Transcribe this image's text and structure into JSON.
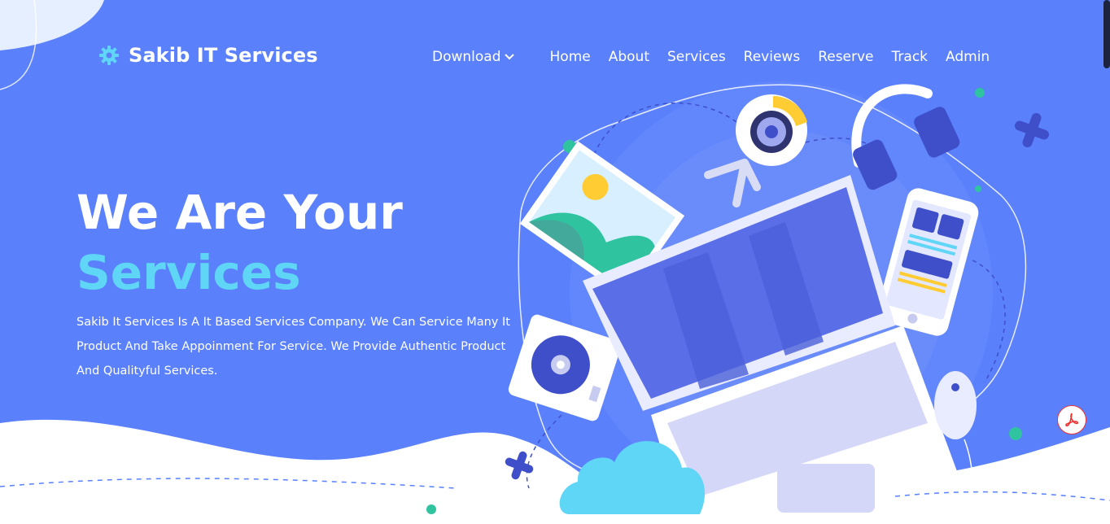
{
  "brand": {
    "name": "Sakib IT Services",
    "icon": "gear-icon"
  },
  "nav": {
    "download": {
      "label": "Download",
      "icon": "chevron-down-icon"
    },
    "items": [
      {
        "label": "Home"
      },
      {
        "label": "About"
      },
      {
        "label": "Services"
      },
      {
        "label": "Reviews"
      },
      {
        "label": "Reserve"
      },
      {
        "label": "Track"
      },
      {
        "label": "Admin"
      }
    ]
  },
  "hero": {
    "title_line1": "We Are Your",
    "title_line2": "Services",
    "description": "Sakib It Services Is A It Based Services Company. We Can Service Many It Product And Take Appoinment For Service. We Provide Authentic Product And Qualityful Services."
  },
  "colors": {
    "background": "#5a80fb",
    "accent": "#5fd6f6",
    "white": "#ffffff"
  },
  "floating_button": {
    "icon": "pdf-icon"
  }
}
